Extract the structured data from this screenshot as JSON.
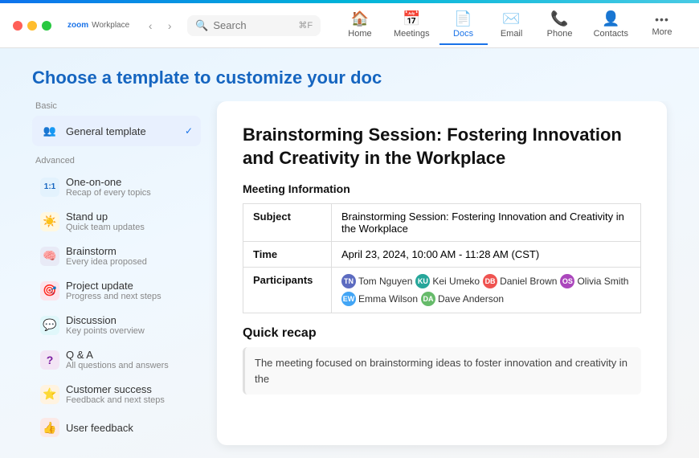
{
  "titlebar": {
    "app_name": "Workplace",
    "zoom_label": "zoom",
    "search_placeholder": "Search",
    "search_shortcut": "⌘F",
    "nav_back": "‹",
    "nav_forward": "›",
    "tabs": [
      {
        "id": "home",
        "icon": "🏠",
        "label": "Home",
        "active": false
      },
      {
        "id": "meetings",
        "icon": "📅",
        "label": "Meetings",
        "active": false
      },
      {
        "id": "docs",
        "icon": "📄",
        "label": "Docs",
        "active": true
      },
      {
        "id": "email",
        "icon": "✉️",
        "label": "Email",
        "active": false
      },
      {
        "id": "phone",
        "icon": "📞",
        "label": "Phone",
        "active": false
      },
      {
        "id": "contacts",
        "icon": "👤",
        "label": "Contacts",
        "active": false
      },
      {
        "id": "more",
        "icon": "···",
        "label": "More",
        "active": false
      }
    ]
  },
  "page": {
    "title": "Choose a template to customize your doc"
  },
  "sidebar": {
    "basic_label": "Basic",
    "advanced_label": "Advanced",
    "items_basic": [
      {
        "id": "general",
        "icon": "👥",
        "icon_bg": "#e8f0fe",
        "name": "General template",
        "desc": "",
        "active": true,
        "check": true
      }
    ],
    "items_advanced": [
      {
        "id": "one-on-one",
        "icon": "1:1",
        "icon_bg": "#e3f2fd",
        "icon_color": "#1565c0",
        "name": "One-on-one",
        "desc": "Recap of every topics"
      },
      {
        "id": "standup",
        "icon": "☀️",
        "icon_bg": "#fff8e1",
        "name": "Stand up",
        "desc": "Quick team updates"
      },
      {
        "id": "brainstorm",
        "icon": "🧠",
        "icon_bg": "#e8eaf6",
        "name": "Brainstorm",
        "desc": "Every idea proposed"
      },
      {
        "id": "project-update",
        "icon": "🎯",
        "icon_bg": "#fce4ec",
        "name": "Project update",
        "desc": "Progress and next steps"
      },
      {
        "id": "discussion",
        "icon": "💬",
        "icon_bg": "#e0f7fa",
        "name": "Discussion",
        "desc": "Key points overview"
      },
      {
        "id": "qa",
        "icon": "❓",
        "icon_bg": "#f3e5f5",
        "icon_color": "#7b1fa2",
        "name": "Q & A",
        "desc": "All questions and answers"
      },
      {
        "id": "customer-success",
        "icon": "⭐",
        "icon_bg": "#fff3e0",
        "name": "Customer success",
        "desc": "Feedback and next steps"
      },
      {
        "id": "user-feedback",
        "icon": "👍",
        "icon_bg": "#fbe9e7",
        "name": "User feedback",
        "desc": ""
      }
    ]
  },
  "preview": {
    "title": "Brainstorming Session: Fostering Innovation and Creativity in the Workplace",
    "meeting_info_label": "Meeting Information",
    "table_rows": [
      {
        "label": "Subject",
        "value": "Brainstorming Session: Fostering Innovation and Creativity in the Workplace"
      },
      {
        "label": "Time",
        "value": "April 23, 2024, 10:00 AM - 11:28 AM (CST)"
      },
      {
        "label": "Participants",
        "value": ""
      }
    ],
    "participants": [
      {
        "name": "Tom Nguyen",
        "color": "#5c6bc0"
      },
      {
        "name": "Kei Umeko",
        "color": "#26a69a"
      },
      {
        "name": "Daniel Brown",
        "color": "#ef5350"
      },
      {
        "name": "Olivia Smith",
        "color": "#ab47bc"
      },
      {
        "name": "Emma Wilson",
        "color": "#42a5f5"
      },
      {
        "name": "Dave Anderson",
        "color": "#66bb6a"
      }
    ],
    "quick_recap_label": "Quick recap",
    "quick_recap_text": "The meeting focused on brainstorming ideas to foster innovation and creativity in the"
  }
}
